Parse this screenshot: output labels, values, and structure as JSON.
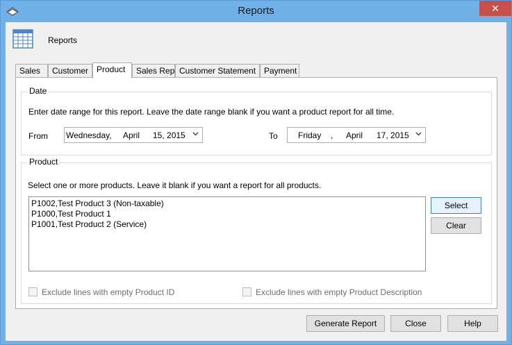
{
  "window": {
    "title": "Reports",
    "close_glyph": "✕"
  },
  "header": {
    "title": "Reports"
  },
  "tabs": [
    {
      "label": "Sales"
    },
    {
      "label": "Customer"
    },
    {
      "label": "Product"
    },
    {
      "label": "Sales Rep."
    },
    {
      "label": "Customer Statement"
    },
    {
      "label": "Payment"
    }
  ],
  "active_tab": "Product",
  "date_group": {
    "label": "Date",
    "instructions": "Enter date range for this report. Leave the date range blank if you want a product report for all time.",
    "from_label": "From",
    "to_label": "To",
    "from_date": {
      "weekday": "Wednesday,",
      "month": "April",
      "day_year": "15, 2015"
    },
    "to_date": {
      "weekday": "Friday",
      "sep": ",",
      "month": "April",
      "day_year": "17, 2015"
    }
  },
  "product_group": {
    "label": "Product",
    "instructions": "Select one or more products. Leave it blank if you want a report for all products.",
    "items": [
      "P1002,Test Product 3 (Non-taxable)",
      "P1000,Test Product 1",
      "P1001,Test Product 2 (Service)"
    ],
    "select_button": "Select",
    "clear_button": "Clear"
  },
  "options": {
    "exclude_empty_id": "Exclude lines with empty Product ID",
    "exclude_empty_desc": "Exclude lines with empty Product Description"
  },
  "footer": {
    "generate_button": "Generate Report",
    "close_button": "Close",
    "help_button": "Help"
  },
  "colors": {
    "titlebar": "#6fb0e6",
    "close": "#c7504a",
    "primary_border": "#3c7fb1"
  }
}
